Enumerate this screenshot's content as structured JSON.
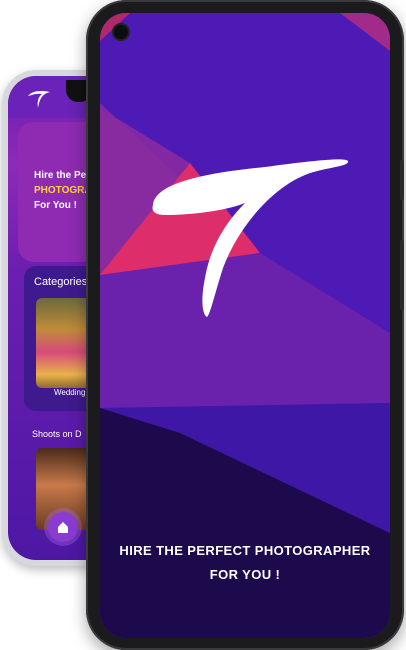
{
  "back_app": {
    "hero_line1": "Hire the Pe",
    "hero_line2": "PHOTOGRA",
    "hero_line3": "For You !",
    "categories_title": "Categories",
    "category_item": "Wedding",
    "shoots_title": "Shoots on D"
  },
  "front_app": {
    "tagline_line1": "HIRE THE PERFECT PHOTOGRAPHER",
    "tagline_line2": "FOR YOU !"
  },
  "colors": {
    "brand_purple": "#4d1ab5",
    "accent_pink": "#dd2d6b",
    "dark_purple": "#1d0a4d",
    "highlight_yellow": "#ffd23a"
  },
  "icons": {
    "logo": "brand-logo-icon",
    "home": "home-icon",
    "camera": "front-camera-icon"
  }
}
